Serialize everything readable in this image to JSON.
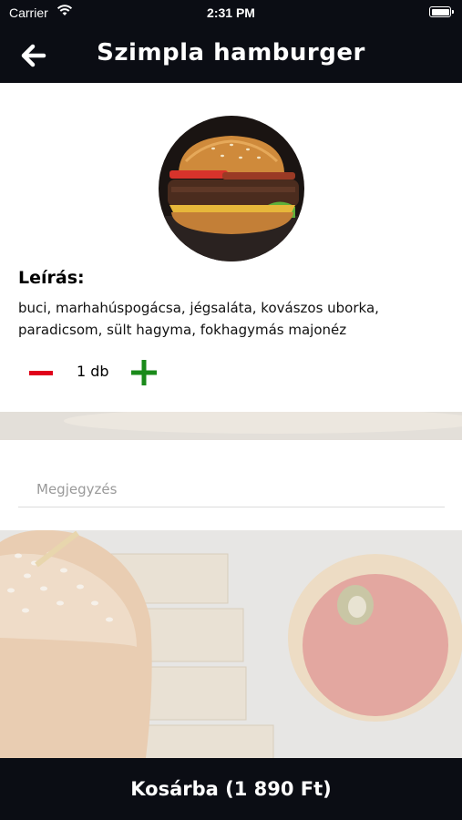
{
  "status_bar": {
    "carrier": "Carrier",
    "time": "2:31 PM"
  },
  "header": {
    "title": "Szimpla hamburger",
    "back_icon": "arrow-left-icon"
  },
  "product": {
    "image": "burger-photo",
    "description_label": "Leírás:",
    "description": "buci, marhahúspogácsa, jégsaláta, kovászos uborka, paradicsom, sült hagyma, fokhagymás majonéz",
    "quantity": "1 db",
    "minus_icon": "minus-icon",
    "plus_icon": "plus-icon"
  },
  "note": {
    "placeholder": "Megjegyzés",
    "value": ""
  },
  "cart_button": {
    "label": "Kosárba (1 890 Ft)"
  },
  "colors": {
    "dark": "#0b0d14",
    "minus": "#e0001b",
    "plus": "#1a8a1a"
  }
}
